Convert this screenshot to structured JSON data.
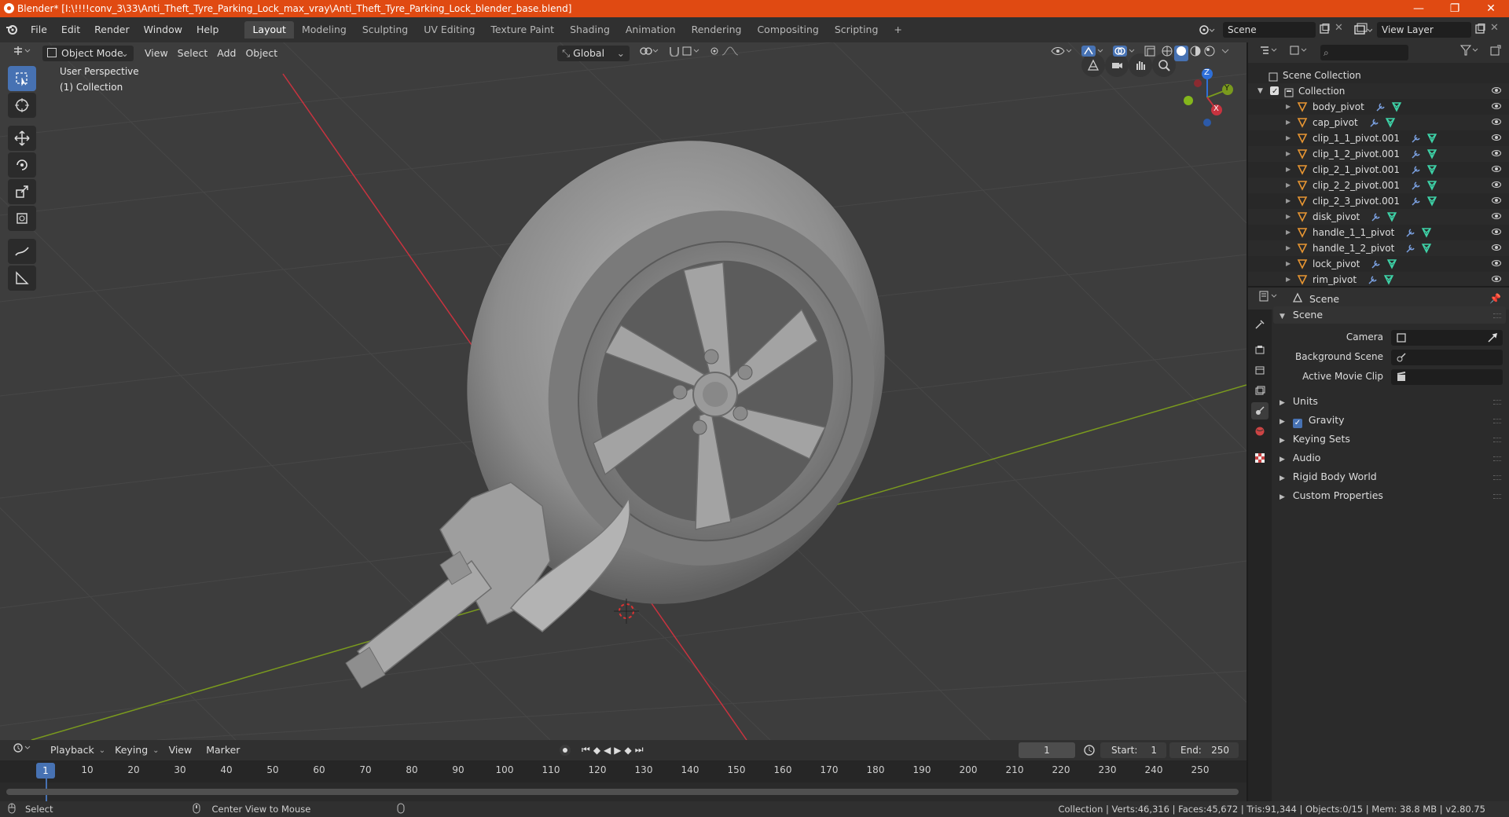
{
  "window": {
    "title": "Blender* [I:\\!!!!conv_3\\33\\Anti_Theft_Tyre_Parking_Lock_max_vray\\Anti_Theft_Tyre_Parking_Lock_blender_base.blend]",
    "minimize": "—",
    "maximize": "❐",
    "close": "✕"
  },
  "menu": [
    "File",
    "Edit",
    "Render",
    "Window",
    "Help"
  ],
  "workspaces": [
    "Layout",
    "Modeling",
    "Sculpting",
    "UV Editing",
    "Texture Paint",
    "Shading",
    "Animation",
    "Rendering",
    "Compositing",
    "Scripting"
  ],
  "workspace_add": "+",
  "scene_field": "Scene",
  "view_layer_field": "View Layer",
  "viewport": {
    "mode": "Object Mode",
    "menus": [
      "View",
      "Select",
      "Add",
      "Object"
    ],
    "transform_orientation": "Global",
    "perspective_label": "User Perspective",
    "collection_label": "(1) Collection",
    "gizmo": {
      "z": "Z",
      "y": "Y",
      "x": "X"
    }
  },
  "timeline": {
    "menus": [
      "Playback",
      "Keying",
      "View",
      "Marker"
    ],
    "current_frame": "1",
    "start_label": "Start:",
    "start_value": "1",
    "end_label": "End:",
    "end_value": "250",
    "ticks": [
      "10",
      "20",
      "30",
      "40",
      "50",
      "60",
      "70",
      "80",
      "90",
      "100",
      "110",
      "120",
      "130",
      "140",
      "150",
      "160",
      "170",
      "180",
      "190",
      "200",
      "210",
      "220",
      "230",
      "240",
      "250"
    ],
    "marker": "1"
  },
  "status": {
    "select": "Select",
    "center_view": "Center View to Mouse",
    "stats": "Collection | Verts:46,316 | Faces:45,672 | Tris:91,344 | Objects:0/15 | Mem: 38.8 MB | v2.80.75"
  },
  "outliner": {
    "search_placeholder": "",
    "root": "Scene Collection",
    "collection": "Collection",
    "items": [
      "body_pivot",
      "cap_pivot",
      "clip_1_1_pivot.001",
      "clip_1_2_pivot.001",
      "clip_2_1_pivot.001",
      "clip_2_2_pivot.001",
      "clip_2_3_pivot.001",
      "disk_pivot",
      "handle_1_1_pivot",
      "handle_1_2_pivot",
      "lock_pivot",
      "rim_pivot"
    ]
  },
  "properties": {
    "context": "Scene",
    "panel_title": "Scene",
    "camera_label": "Camera",
    "background_scene_label": "Background Scene",
    "active_movie_clip_label": "Active Movie Clip",
    "sections": [
      "Units",
      "Gravity",
      "Keying Sets",
      "Audio",
      "Rigid Body World",
      "Custom Properties"
    ]
  },
  "colors": {
    "titlebar": "#e04a12",
    "accent": "#4772b3",
    "x_axis": "#c8333f",
    "y_axis": "#7a9a1e",
    "z_axis": "#2e6fd8"
  }
}
